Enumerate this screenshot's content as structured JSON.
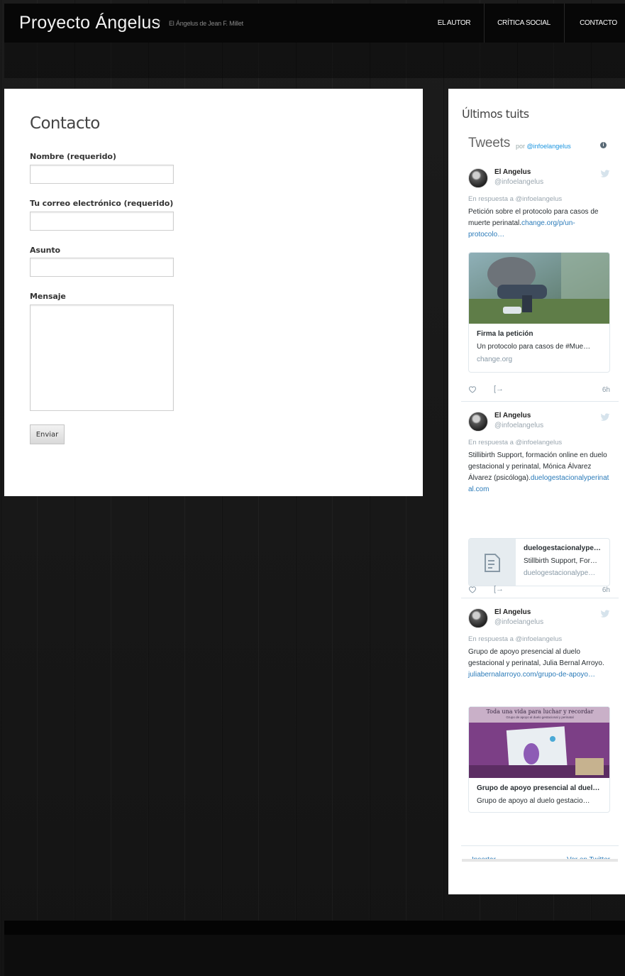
{
  "header": {
    "site_title": "Proyecto Ángelus",
    "separator": "/",
    "tagline": "El Ángelus de Jean F. Millet",
    "nav": [
      "El autor",
      "Crítica social",
      "Contacto"
    ]
  },
  "contact": {
    "title": "Contacto",
    "fields": [
      {
        "label": "Nombre (requerido)",
        "value": ""
      },
      {
        "label": "Tu correo electrónico (requerido)",
        "value": ""
      },
      {
        "label": "Asunto",
        "value": ""
      },
      {
        "label": "Mensaje",
        "value": ""
      }
    ],
    "submit_label": "Enviar"
  },
  "sidebar": {
    "title": "Últimos tuits",
    "widget": {
      "title": "Tweets",
      "by_prefix": "por",
      "by_handle": "@infoelangelus",
      "info_icon": "i",
      "tweets": [
        {
          "name": "El Angelus",
          "handle": "@infoelangelus",
          "reply_to": "En respuesta a @infoelangelus",
          "text": "Petición sobre el protocolo para casos de muerte perinatal.",
          "link": "change.org/p/un-protocolo…",
          "card_title": "Firma la petición",
          "card_desc": "Un protocolo para casos de #Mue…",
          "card_domain": "change.org",
          "share_icon": "[→",
          "time": "6h"
        },
        {
          "name": "El Angelus",
          "handle": "@infoelangelus",
          "reply_to": "En respuesta a @infoelangelus",
          "text": "Stillibirth Support, formación online en duelo gestacional y perinatal, Mónica Álvarez Álvarez (psicóloga).",
          "link": "duelogestacionalyperinatal.com",
          "card_title": "duelogestacionalype…",
          "card_desc": "Stillbirth Support, For…",
          "card_domain": "duelogestacionalype…",
          "share_icon": "[→",
          "time": "6h"
        },
        {
          "name": "El Angelus",
          "handle": "@infoelangelus",
          "reply_to": "En respuesta a @infoelangelus",
          "text": "Grupo de apoyo presencial al duelo gestacional y perinatal, Julia Bernal Arroyo.",
          "link": "juliabernalarroyo.com/grupo-de-apoyo…",
          "card_image_headline": "Toda una vida para luchar y recordar",
          "card_image_sub": "Grupo de apoyo al duelo gestacional y perinatal",
          "card_title": "Grupo de apoyo presencial al duel…",
          "card_desc": "Grupo de apoyo al duelo gestacio…"
        }
      ],
      "footer_embed": "Insertar",
      "footer_view": "Ver en Twitter"
    }
  },
  "colors": {
    "link": "#2b7bb9",
    "header_bg": "#070707",
    "panel_bg": "#ffffff"
  }
}
